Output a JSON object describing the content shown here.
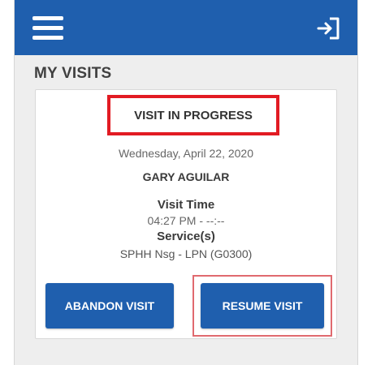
{
  "header": {
    "menu_icon": "hamburger-menu-icon",
    "logout_icon": "logout-icon",
    "bar_color": "#1f5fae"
  },
  "page": {
    "title": "MY VISITS"
  },
  "visit": {
    "status": "VISIT IN PROGRESS",
    "date": "Wednesday, April 22, 2020",
    "patient": "GARY AGUILAR",
    "visit_time_label": "Visit Time",
    "visit_time_value": "04:27 PM - --:--",
    "service_label": "Service(s)",
    "service_value": "SPHH Nsg - LPN (G0300)"
  },
  "actions": {
    "abandon_label": "ABANDON VISIT",
    "resume_label": "RESUME VISIT",
    "button_color": "#1f5fae",
    "highlight_color": "#e21b23"
  }
}
